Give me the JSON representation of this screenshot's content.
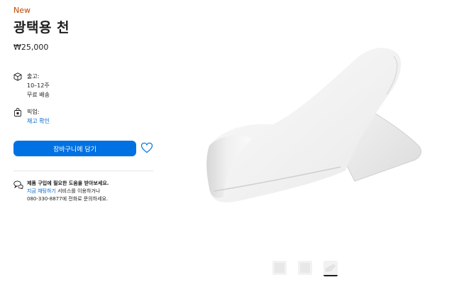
{
  "product": {
    "badge": "New",
    "title": "광택용 천",
    "price": "₩25,000"
  },
  "delivery": {
    "icon": "box-icon",
    "label": "출고:",
    "timeframe": "10–12주",
    "shipping": "무료 배송"
  },
  "pickup": {
    "icon": "bag-icon",
    "label": "픽업:",
    "link": "재고 확인"
  },
  "cart": {
    "button_label": "장바구니에 담기"
  },
  "help": {
    "icon": "chat-icon",
    "headline": "제품 구입에 필요한 도움을 받아보세요.",
    "link": "지금 채팅하기",
    "link_suffix": " 서비스를 이용하거나",
    "phone_line": "080-330-8877에 전화로 문의하세요."
  },
  "colors": {
    "accent": "#0071e3",
    "new_badge": "#bf4800",
    "link": "#0066cc"
  },
  "thumbnails": [
    {
      "active": false
    },
    {
      "active": false
    },
    {
      "active": true
    }
  ]
}
